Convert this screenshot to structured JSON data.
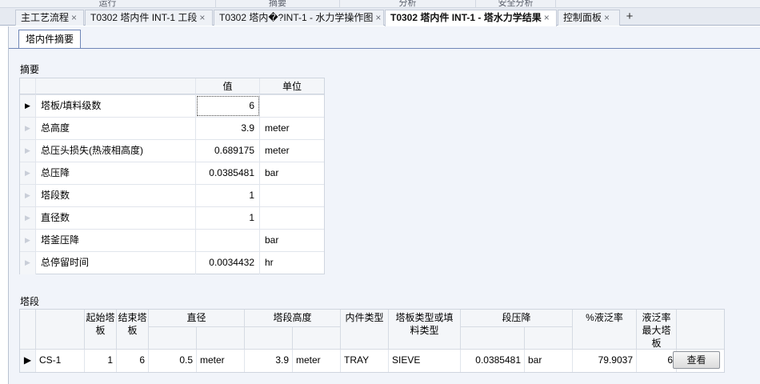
{
  "ribbon": {
    "groups": [
      "运行",
      "摘要",
      "分析",
      "安全分析"
    ]
  },
  "doc_tabs": [
    {
      "label": "主工艺流程"
    },
    {
      "label": "T0302 塔内件 INT-1 工段"
    },
    {
      "label": "T0302 塔内�?INT-1 - 水力学操作图"
    },
    {
      "label": "T0302 塔内件 INT-1 - 塔水力学结果"
    },
    {
      "label": "控制面板"
    }
  ],
  "close_glyph": "×",
  "add_glyph": "+",
  "inner_tab": {
    "label": "塔内件摘要"
  },
  "summary": {
    "title": "摘要",
    "headers": {
      "value": "值",
      "unit": "单位"
    },
    "rows": [
      {
        "name": "塔板/填料级数",
        "value": "6",
        "unit": ""
      },
      {
        "name": "总高度",
        "value": "3.9",
        "unit": "meter"
      },
      {
        "name": "总压头损失(热液相高度)",
        "value": "0.689175",
        "unit": "meter"
      },
      {
        "name": "总压降",
        "value": "0.0385481",
        "unit": "bar"
      },
      {
        "name": "塔段数",
        "value": "1",
        "unit": ""
      },
      {
        "name": "直径数",
        "value": "1",
        "unit": ""
      },
      {
        "name": "塔釜压降",
        "value": "",
        "unit": "bar"
      },
      {
        "name": "总停留时间",
        "value": "0.0034432",
        "unit": "hr"
      }
    ]
  },
  "sections": {
    "title": "塔段",
    "headers": {
      "start_tray": "起始塔板",
      "end_tray": "结束塔板",
      "diameter": "直径",
      "height": "塔段高度",
      "internal_type": "内件类型",
      "tray_type": "塔板类型或填料类型",
      "pressure_drop": "段压降",
      "flood": "%液泛率",
      "max_flood_tray": "液泛率最大塔板"
    },
    "rows": [
      {
        "name": "CS-1",
        "start_tray": "1",
        "end_tray": "6",
        "diameter": "0.5",
        "diameter_unit": "meter",
        "height": "3.9",
        "height_unit": "meter",
        "internal_type": "TRAY",
        "tray_type": "SIEVE",
        "pressure_drop": "0.0385481",
        "pressure_drop_unit": "bar",
        "flood": "79.9037",
        "max_flood_tray": "6",
        "view_label": "查看"
      }
    ]
  }
}
